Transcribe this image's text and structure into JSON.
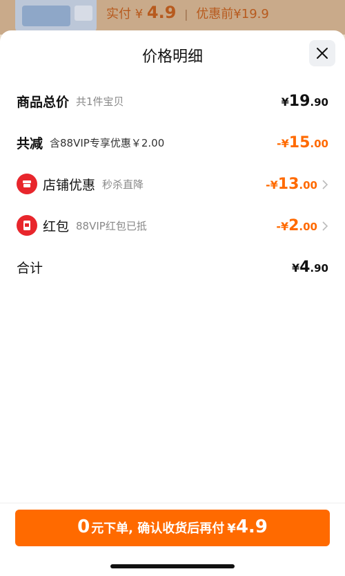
{
  "header": {
    "actual_label": "实付",
    "yen": "¥",
    "actual_price": "4.9",
    "separator": "|",
    "before_label": "优惠前¥19.9"
  },
  "sheet": {
    "title": "价格明细"
  },
  "rows": {
    "total": {
      "label": "商品总价",
      "sub": "共1件宝贝",
      "yen": "¥",
      "int": "19",
      "dec": ".90"
    },
    "reduce": {
      "label": "共减",
      "sub": "含88VIP专享优惠￥2.00",
      "yen": "-¥",
      "int": "15",
      "dec": ".00"
    },
    "shop": {
      "label": "店铺优惠",
      "sub": "秒杀直降",
      "yen": "-¥",
      "int": "13",
      "dec": ".00"
    },
    "redpack": {
      "label": "红包",
      "sub": "88VIP红包已抵",
      "yen": "-¥",
      "int": "2",
      "dec": ".00"
    },
    "sum": {
      "label": "合计",
      "yen": "¥",
      "int": "4",
      "dec": ".90"
    }
  },
  "cta": {
    "zero": "0",
    "text": "元下单, 确认收货后再付",
    "yen": "¥",
    "price": "4.9"
  },
  "colors": {
    "accent": "#ff6a00",
    "icon_red": "#e8262c"
  },
  "icons": [
    "close-icon",
    "shop-discount-icon",
    "red-packet-icon",
    "chevron-right-icon"
  ]
}
